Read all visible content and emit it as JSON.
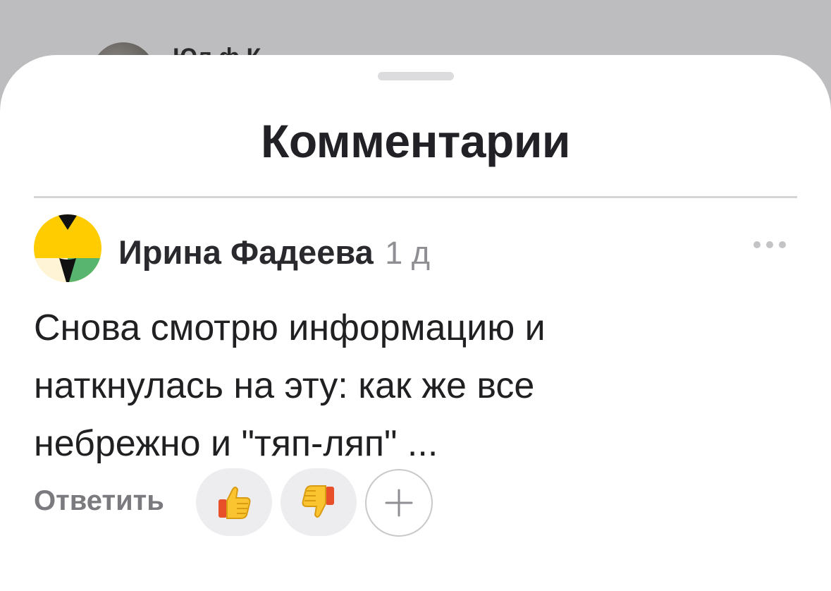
{
  "background_behind_sheet": {
    "partial_text": "Юл    ф   К"
  },
  "sheet": {
    "title": "Комментарии"
  },
  "comment": {
    "author": "Ирина Фадеева",
    "age": "1 д",
    "text": "Снова смотрю информацию и наткнулась на эту: как же все небрежно и \"тяп-ляп\" ...",
    "reply_label": "Ответить",
    "reactions": [
      {
        "name": "like",
        "icon": "thumbs-up-icon"
      },
      {
        "name": "dislike",
        "icon": "thumbs-down-icon"
      }
    ],
    "add_reaction_icon": "plus-icon",
    "more_icon": "more-dots-icon"
  },
  "colors": {
    "accent_yellow": "#FFCC00",
    "avatar_green": "#58B56F",
    "avatar_cream": "#FFF4D6",
    "reply_text": "#7A7A7F"
  }
}
